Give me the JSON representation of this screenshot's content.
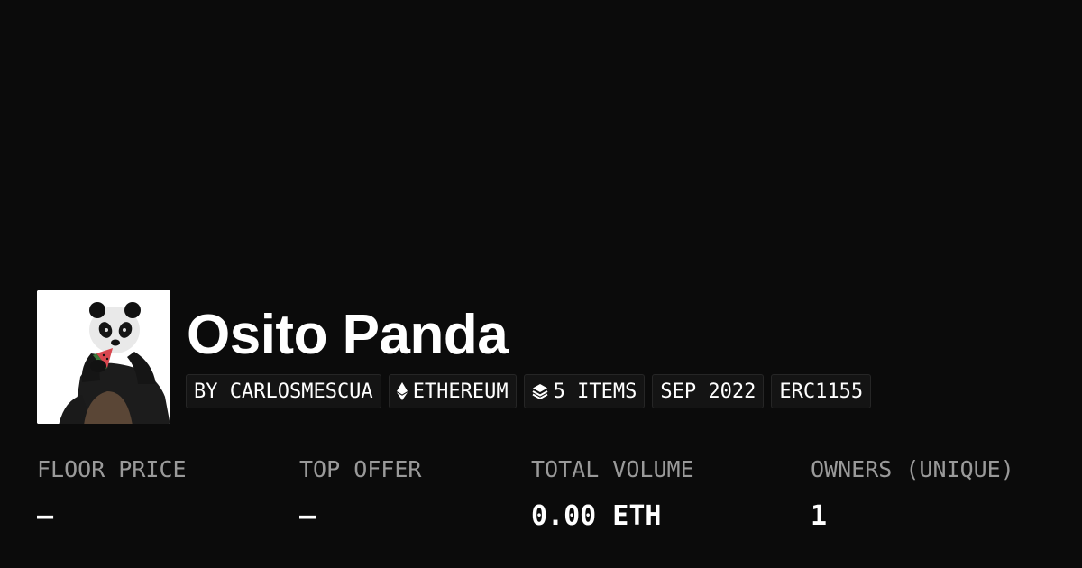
{
  "collection": {
    "name": "Osito Panda",
    "avatar_icon": "panda-eating-watermelon-image"
  },
  "chips": {
    "creator": "BY CARLOSMESCUA",
    "chain": "ETHEREUM",
    "chain_icon": "ethereum-icon",
    "items": "5 ITEMS",
    "items_icon": "layers-icon",
    "date": "SEP 2022",
    "standard": "ERC1155"
  },
  "stats": {
    "floor_price": {
      "label": "FLOOR PRICE",
      "value": "—"
    },
    "top_offer": {
      "label": "TOP OFFER",
      "value": "—"
    },
    "total_volume": {
      "label": "TOTAL VOLUME",
      "value": "0.00 ETH"
    },
    "owners": {
      "label": "OWNERS (UNIQUE)",
      "value": "1"
    }
  },
  "colors": {
    "background": "#0b0b0b",
    "text": "#ffffff",
    "muted_text": "#9a9a9a",
    "chip_background": "#141414",
    "chip_border": "#262626"
  }
}
